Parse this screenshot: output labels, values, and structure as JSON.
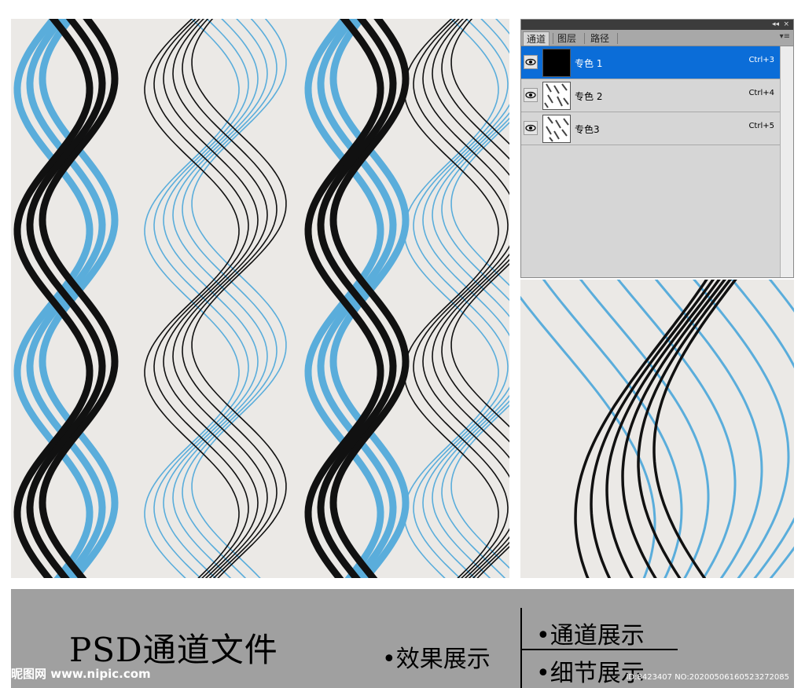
{
  "panel": {
    "tabs": [
      "通道",
      "图层",
      "路径"
    ],
    "collapse_icon": "◂◂",
    "close_icon": "×",
    "menu_icon": "▾≡",
    "channels": [
      {
        "name": "专色 1",
        "shortcut": "Ctrl+3",
        "thumb": "black",
        "selected": true
      },
      {
        "name": "专色 2",
        "shortcut": "Ctrl+4",
        "thumb": "pattern",
        "selected": false
      },
      {
        "name": "专色3",
        "shortcut": "Ctrl+5",
        "thumb": "pattern",
        "selected": false
      }
    ]
  },
  "band": {
    "title": "PSD通道文件",
    "effect_label": "•效果展示",
    "channel_label": "•通道展示",
    "detail_label": "•细节展示",
    "watermark": "昵图网 www.nipic.com",
    "id_text": "ID:8423407 NO:20200506160523272085"
  },
  "colors": {
    "background": "#ebe9e6",
    "blue": "#5aaddb",
    "black": "#111111",
    "band": "#a0a0a0",
    "selection": "#0b6dd8"
  }
}
